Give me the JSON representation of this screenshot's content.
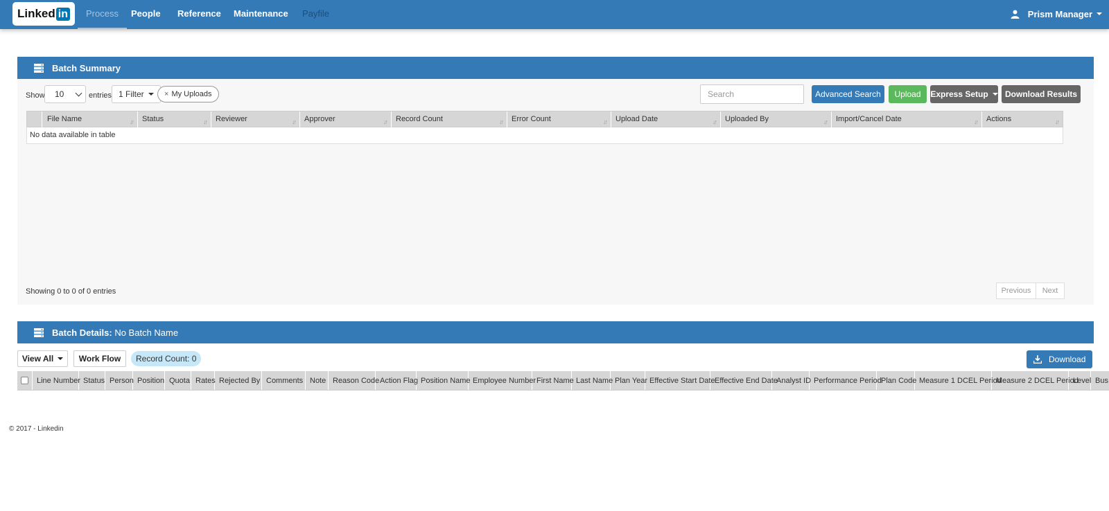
{
  "nav": {
    "logo_text": "Linked",
    "logo_in": "in",
    "items": [
      "Process",
      "People",
      "Reference",
      "Maintenance",
      "Payfile"
    ],
    "user": "Prism Manager"
  },
  "batch_summary": {
    "title": "Batch Summary",
    "show_label": "Show",
    "entries_value": "10",
    "entries_label": "entries",
    "filter_label": "1 Filter",
    "pill_label": "My Uploads",
    "pill_x": "×",
    "search_placeholder": "Search",
    "advanced_search": "Advanced Search",
    "upload": "Upload",
    "express_setup": "Express Setup",
    "download_results": "Download Results",
    "columns": [
      "File Name",
      "Status",
      "Reviewer",
      "Approver",
      "Record Count",
      "Error Count",
      "Upload Date",
      "Uploaded By",
      "Import/Cancel Date",
      "Actions"
    ],
    "sort_glyph": "↓↑",
    "empty_text": "No data available in table",
    "showing": "Showing 0 to 0 of 0 entries",
    "previous": "Previous",
    "next": "Next"
  },
  "batch_details": {
    "title_bold": "Batch Details:",
    "title_rest": "No Batch Name",
    "view_all": "View All",
    "work_flow": "Work Flow",
    "record_count": "Record Count: 0",
    "download": "Download",
    "columns": [
      "Line Number",
      "Status",
      "Person",
      "Position",
      "Quota",
      "Rates",
      "Rejected By",
      "Comments",
      "Note",
      "Reason Code",
      "Action Flag",
      "Position Name",
      "Employee Number",
      "First Name",
      "Last Name",
      "Plan Year",
      "Effective Start Date",
      "Effective End Date",
      "Analyst ID",
      "Performance Period",
      "Plan Code",
      "Measure 1 DCEL Period",
      "Measure 2 DCEL Period",
      "Level",
      "Bus"
    ]
  },
  "footer": "© 2017 - Linkedin",
  "colors": {
    "primary": "#337ab7",
    "success": "#5cb85c",
    "grey": "#666666"
  }
}
